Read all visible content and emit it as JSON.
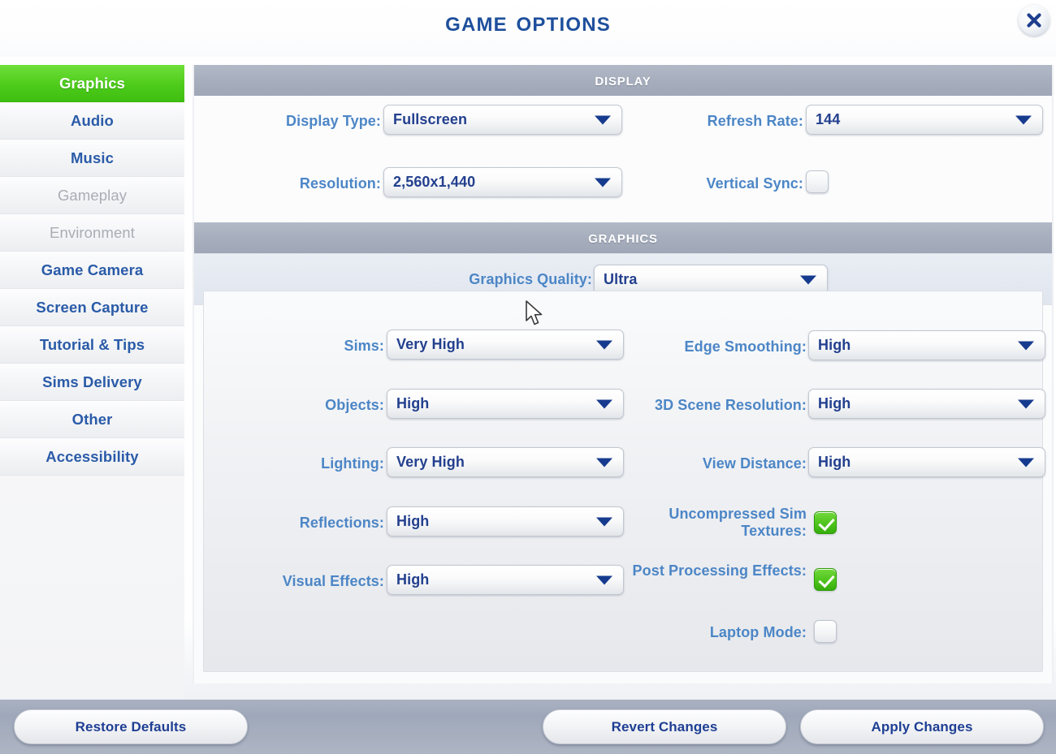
{
  "window": {
    "title": "Game Options",
    "close_icon": "close-x-icon"
  },
  "colors": {
    "accent_green": "#4ecb1b",
    "label_blue": "#4c86c6",
    "value_blue": "#23408e",
    "title_blue": "#1e4f9c",
    "section_header_bg": "#a7aebd",
    "footer_bg": "#9fa8ba",
    "highlight_row_bg": "#e4e9f1"
  },
  "sidebar": {
    "items": [
      {
        "label": "Graphics",
        "state": "active"
      },
      {
        "label": "Audio",
        "state": "normal"
      },
      {
        "label": "Music",
        "state": "normal"
      },
      {
        "label": "Gameplay",
        "state": "disabled"
      },
      {
        "label": "Environment",
        "state": "disabled"
      },
      {
        "label": "Game Camera",
        "state": "normal"
      },
      {
        "label": "Screen Capture",
        "state": "normal"
      },
      {
        "label": "Tutorial & Tips",
        "state": "normal"
      },
      {
        "label": "Sims Delivery",
        "state": "normal"
      },
      {
        "label": "Other",
        "state": "normal"
      },
      {
        "label": "Accessibility",
        "state": "normal"
      }
    ]
  },
  "display_section": {
    "header": "Display",
    "display_type": {
      "label": "Display Type:",
      "value": "Fullscreen",
      "control": "dropdown"
    },
    "resolution": {
      "label": "Resolution:",
      "value": "2,560x1,440",
      "control": "dropdown"
    },
    "refresh_rate": {
      "label": "Refresh Rate:",
      "value": "144",
      "control": "dropdown"
    },
    "vertical_sync": {
      "label": "Vertical Sync:",
      "value": "unchecked",
      "control": "checkbox"
    }
  },
  "graphics_section": {
    "header": "Graphics",
    "graphics_quality": {
      "label": "Graphics Quality:",
      "value": "Ultra",
      "control": "dropdown"
    },
    "sims": {
      "label": "Sims:",
      "value": "Very High",
      "control": "dropdown"
    },
    "objects": {
      "label": "Objects:",
      "value": "High",
      "control": "dropdown"
    },
    "lighting": {
      "label": "Lighting:",
      "value": "Very High",
      "control": "dropdown"
    },
    "reflections": {
      "label": "Reflections:",
      "value": "High",
      "control": "dropdown"
    },
    "visual_effects": {
      "label": "Visual Effects:",
      "value": "High",
      "control": "dropdown"
    },
    "edge_smoothing": {
      "label": "Edge Smoothing:",
      "value": "High",
      "control": "dropdown"
    },
    "scene_resolution": {
      "label": "3D Scene Resolution:",
      "value": "High",
      "control": "dropdown"
    },
    "view_distance": {
      "label": "View Distance:",
      "value": "High",
      "control": "dropdown"
    },
    "uncompressed_sim_textures": {
      "label": "Uncompressed Sim Textures:",
      "value": "checked",
      "control": "checkbox"
    },
    "post_processing_effects": {
      "label": "Post Processing Effects:",
      "value": "checked",
      "control": "checkbox"
    },
    "laptop_mode": {
      "label": "Laptop Mode:",
      "value": "unchecked",
      "control": "checkbox"
    }
  },
  "footer": {
    "restore_defaults": "Restore Defaults",
    "revert_changes": "Revert Changes",
    "apply_changes": "Apply Changes"
  }
}
